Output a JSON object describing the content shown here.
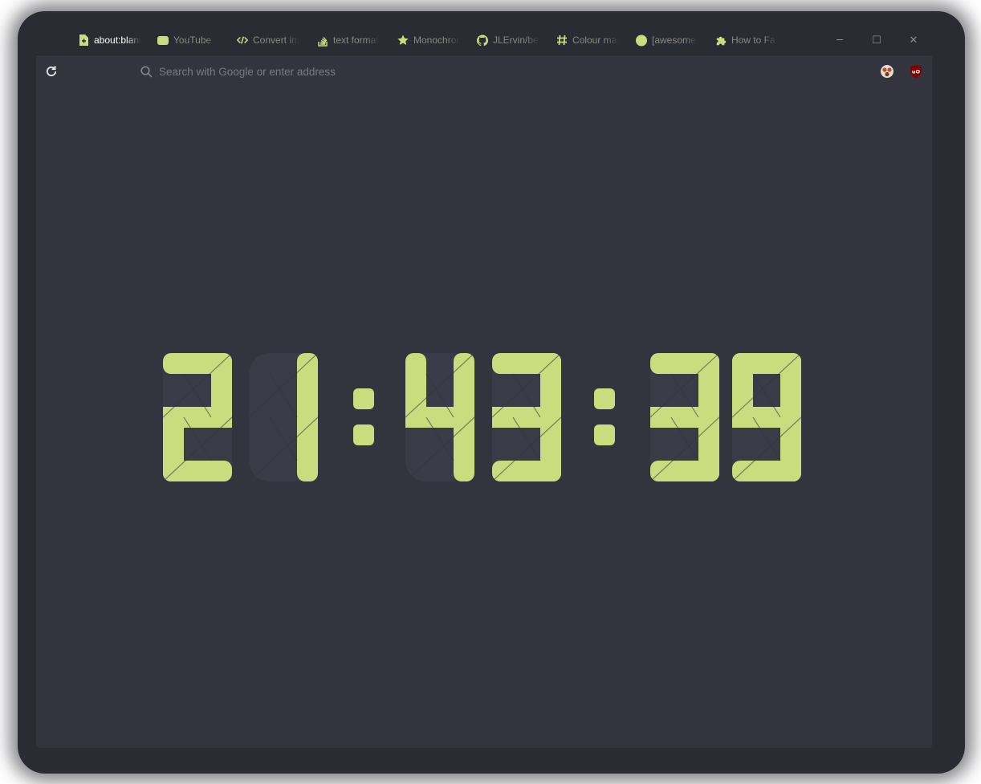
{
  "tabs": [
    {
      "label": "about:blank",
      "icon": "new-page-icon",
      "active": true
    },
    {
      "label": "YouTube",
      "icon": "youtube-icon",
      "active": false
    },
    {
      "label": "Convert image",
      "icon": "code-icon",
      "active": false
    },
    {
      "label": "text formatting",
      "icon": "stackoverflow-icon",
      "active": false
    },
    {
      "label": "Monochrome",
      "icon": "star-icon",
      "active": false
    },
    {
      "label": "JLErvin/berry",
      "icon": "github-icon",
      "active": false
    },
    {
      "label": "Colour match",
      "icon": "hash-icon",
      "active": false
    },
    {
      "label": "[awesome",
      "icon": "circle-icon",
      "active": false
    },
    {
      "label": "How to Fa",
      "icon": "puzzle-icon",
      "active": false
    }
  ],
  "window_controls": {
    "minimize": "─",
    "maximize": "☐",
    "close": "✕"
  },
  "search": {
    "placeholder": "Search with Google or enter address",
    "value": ""
  },
  "clock": {
    "hours": "21",
    "minutes": "43",
    "seconds": "39",
    "separator": ":"
  },
  "colors": {
    "accent": "#c9dd7e",
    "background": "#34343f",
    "ghost": "#3a3b47",
    "tabbar": "#2b2b34"
  }
}
